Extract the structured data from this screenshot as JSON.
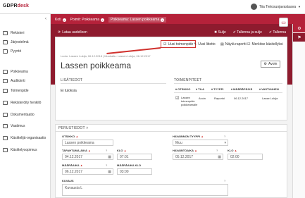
{
  "app": {
    "logo_text": "GDPR",
    "logo_accent": "desk",
    "user_name": "Tiia Tietosuojavastaava"
  },
  "sidebar": {
    "items": [
      {
        "label": "Rekisteri",
        "icon": "book-icon"
      },
      {
        "label": "Järjestelmä",
        "icon": "monitor-icon"
      },
      {
        "label": "Pyyntö",
        "icon": "inbox-icon"
      },
      {
        "label": "Poikkeama",
        "icon": "warning-icon"
      },
      {
        "label": "Auditointi",
        "icon": "audit-icon"
      },
      {
        "label": "Toimenpide",
        "icon": "checklist-icon"
      },
      {
        "label": "Rekisteröity henkilö",
        "icon": "user-icon"
      },
      {
        "label": "Dokumentaatio",
        "icon": "document-icon"
      },
      {
        "label": "Vaatimus",
        "icon": "requirement-icon"
      },
      {
        "label": "Käsittelijä-organisaatio",
        "icon": "organization-icon"
      },
      {
        "label": "Käsittelysopimus",
        "icon": "contract-icon"
      }
    ]
  },
  "breadcrumbs": [
    {
      "label": "Koti"
    },
    {
      "label": "Poimit: Poikkeama"
    },
    {
      "label": "Poikkeama: Lassen poikkeama"
    }
  ],
  "actionbar": {
    "load_label": "Lataa uudelleen",
    "close_label": "Sulje",
    "save_close_label": "Tallenna ja sulje",
    "save_label": "Tallenna"
  },
  "toolbar": {
    "new_action": "Uusi toimenpide",
    "new_attachment": "Uusi liitetto",
    "show_report": "Näytä raportti",
    "mark_processed": "Merkitse käsitellyksi"
  },
  "record": {
    "meta": "Luotu: Lassen Lukija, 06.12.2018  |  Muokattu: Lassen Lukija, 06.12.2017",
    "title": "Lassen poikkeama",
    "open_button": "Avoin"
  },
  "lisatiedot": {
    "heading": "LISÄTIEDOT",
    "value": "Ei tuloksia"
  },
  "toimenpiteet": {
    "heading": "TOIMENPITEET",
    "columns": [
      "OTSIKKO",
      "TILA",
      "TYYPPI",
      "MÄÄRÄPÄIVÄ",
      "VASTUUHEN"
    ],
    "rows": [
      {
        "title": "Lassen toimenpide poikkeamalle",
        "status": "Avoin",
        "type": "Raportoi",
        "due": "06.12.2017",
        "owner": "Lasse Lukija"
      }
    ]
  },
  "perustiedot": {
    "heading": "PERUSTIEDOT",
    "fields": {
      "otsikko_label": "OTSIKKO",
      "otsikko_value": "Lassen poikkeama",
      "tyyppi_label": "HAVAINNON TYYPPI",
      "tyyppi_value": "Muu",
      "tapahtuma_label": "TAPAHTUMA-AIKA",
      "tapahtuma_date": "04.12.2017",
      "klo_label": "KLO",
      "tapahtuma_time": "07:01",
      "havainto_label": "HAVAINTOAIKA",
      "havainto_date": "05.12.2017",
      "havainto_time": "02:00",
      "maaraika_label": "MÄÄRÄAIKA",
      "maaraika_date": "06.12.2017",
      "maaraika_klo_label": "MÄÄRÄAIKA KLO",
      "maaraika_time": "03:00",
      "kuvaus_label": "KUVAUS",
      "kuvaus_value": "Kuvausta L"
    }
  },
  "colors": {
    "accent": "#b5223a",
    "accent_dark": "#8e1b2e",
    "highlight": "#d0312d"
  }
}
